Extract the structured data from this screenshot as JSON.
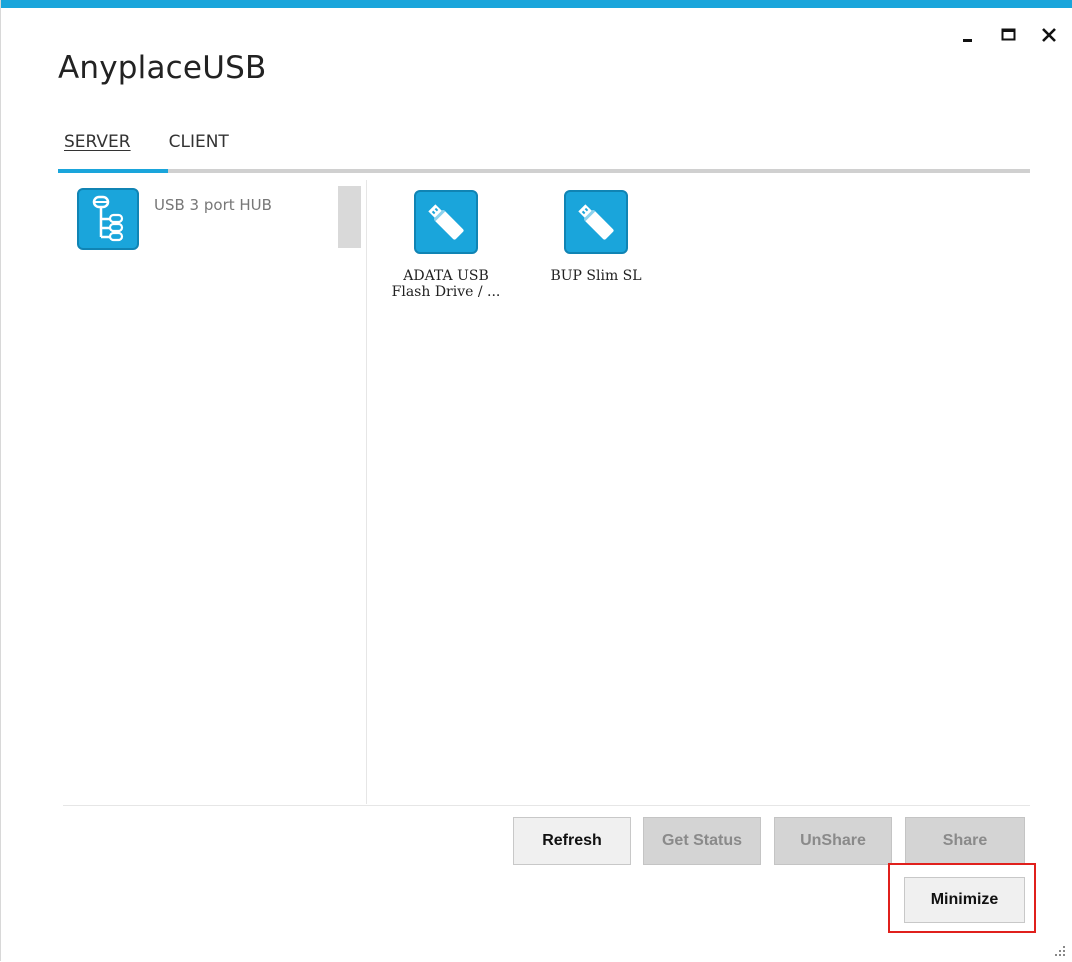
{
  "app": {
    "title": "AnyplaceUSB",
    "accent_color": "#1aa5db"
  },
  "window_controls": {
    "minimize_icon": "minimize-icon",
    "maximize_icon": "maximize-icon",
    "close_icon": "close-icon"
  },
  "tabs": [
    {
      "label": "SERVER",
      "active": true
    },
    {
      "label": "CLIENT",
      "active": false
    }
  ],
  "hubs": [
    {
      "label": "USB 3 port HUB",
      "icon": "usb-hub-tree-icon"
    }
  ],
  "devices": [
    {
      "label_line1": "ADATA USB",
      "label_line2": "Flash Drive / ...",
      "icon": "usb-flash-drive-icon"
    },
    {
      "label_line1": "BUP Slim SL",
      "label_line2": "",
      "icon": "usb-flash-drive-icon"
    }
  ],
  "buttons": {
    "refresh": "Refresh",
    "get_status": "Get Status",
    "unshare": "UnShare",
    "share": "Share",
    "minimize": "Minimize"
  },
  "highlight_color": "#e0201c"
}
